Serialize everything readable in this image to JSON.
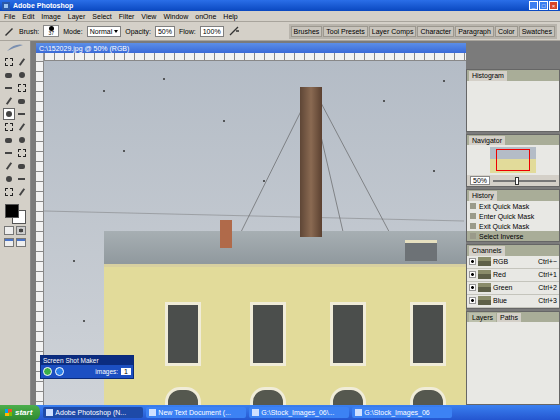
{
  "window": {
    "title": "Adobe Photoshop",
    "controls": [
      "_",
      "□",
      "×"
    ]
  },
  "menu": [
    "File",
    "Edit",
    "Image",
    "Layer",
    "Select",
    "Filter",
    "View",
    "Window",
    "onOne",
    "Help"
  ],
  "options": {
    "brush_label": "Brush:",
    "brush_size": "37",
    "mode_label": "Mode:",
    "mode": "Normal",
    "opacity_label": "Opacity:",
    "opacity": "50%",
    "flow_label": "Flow:",
    "flow": "100%"
  },
  "palette_well": [
    "Brushes",
    "Tool Presets",
    "Layer Comps",
    "Character",
    "Paragraph",
    "Color",
    "Swatches"
  ],
  "toolbox": {
    "tools": [
      {
        "selected": false
      },
      {
        "selected": false
      },
      {
        "selected": false
      },
      {
        "selected": false
      },
      {
        "selected": false
      },
      {
        "selected": false
      },
      {
        "selected": false
      },
      {
        "selected": false
      },
      {
        "selected": true
      },
      {
        "selected": false
      },
      {
        "selected": false
      },
      {
        "selected": false
      },
      {
        "selected": false
      },
      {
        "selected": false
      },
      {
        "selected": false
      },
      {
        "selected": false
      },
      {
        "selected": false
      },
      {
        "selected": false
      },
      {
        "selected": false
      },
      {
        "selected": false
      },
      {
        "selected": false
      },
      {
        "selected": false
      }
    ],
    "foreground": "#000000",
    "background": "#ffffff"
  },
  "document": {
    "title": "C:\\152029.jpg @ 50% (RGB)"
  },
  "histogram": {
    "title": "Histogram"
  },
  "navigator": {
    "title": "Navigator",
    "zoom": "50%",
    "level": 0.35
  },
  "history": {
    "title": "History",
    "items": [
      {
        "label": "Exit Quick Mask",
        "selected": false
      },
      {
        "label": "Enter Quick Mask",
        "selected": false
      },
      {
        "label": "Exit Quick Mask",
        "selected": false
      },
      {
        "label": "Select Inverse",
        "selected": true
      }
    ]
  },
  "channels": {
    "title": "Channels",
    "items": [
      {
        "name": "RGB",
        "shortcut": "Ctrl+~",
        "visible": true
      },
      {
        "name": "Red",
        "shortcut": "Ctrl+1",
        "visible": true
      },
      {
        "name": "Green",
        "shortcut": "Ctrl+2",
        "visible": true
      },
      {
        "name": "Blue",
        "shortcut": "Ctrl+3",
        "visible": true
      }
    ]
  },
  "layers": {
    "tabs": [
      {
        "label": "Layers",
        "selected": false
      },
      {
        "label": "Paths",
        "selected": true
      }
    ]
  },
  "screen_shot_maker": {
    "title": "Screen Shot Maker",
    "images_label": "images:",
    "images": "1"
  },
  "taskbar": {
    "start": "start",
    "tasks": [
      {
        "label": "Adobe Photoshop (N...",
        "selected": true
      },
      {
        "label": "New Text Document (...",
        "selected": false
      },
      {
        "label": "G:\\Stock_Images_06\\...",
        "selected": false
      },
      {
        "label": "G:\\Stock_Images_06",
        "selected": false
      }
    ]
  }
}
